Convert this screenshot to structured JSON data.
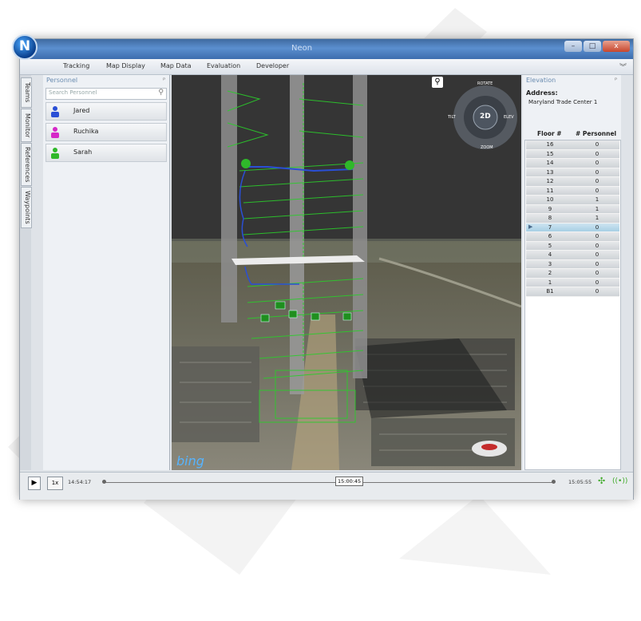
{
  "app": {
    "title": "Neon",
    "logo_letter": "N"
  },
  "window_buttons": [
    "–",
    "□",
    "x"
  ],
  "menu": [
    "Tracking",
    "Map Display",
    "Map Data",
    "Evaluation",
    "Developer"
  ],
  "side_tabs": [
    "Teams",
    "Monitor",
    "References",
    "Waypoints"
  ],
  "personnel": {
    "title": "Personnel",
    "pin": "ᴾ",
    "search_placeholder": "Search Personnel",
    "items": [
      {
        "name": "Jared",
        "color": "#2a4fd6"
      },
      {
        "name": "Ruchika",
        "color": "#d628c8"
      },
      {
        "name": "Sarah",
        "color": "#2fb82a"
      }
    ]
  },
  "map": {
    "watermark": "bing",
    "nav_labels": {
      "rotate": "ROTATE",
      "tilt": "TILT",
      "elev": "ELEV",
      "zoom": "ZOOM",
      "mode": "2D"
    }
  },
  "elevation": {
    "title": "Elevation",
    "pin": "ᴾ",
    "address_label": "Address:",
    "address": "Maryland Trade Center 1",
    "col_floor": "Floor #",
    "col_personnel": "# Personnel",
    "selected_floor": "7",
    "floors": [
      {
        "floor": "16",
        "count": "0"
      },
      {
        "floor": "15",
        "count": "0"
      },
      {
        "floor": "14",
        "count": "0"
      },
      {
        "floor": "13",
        "count": "0"
      },
      {
        "floor": "12",
        "count": "0"
      },
      {
        "floor": "11",
        "count": "0"
      },
      {
        "floor": "10",
        "count": "1"
      },
      {
        "floor": "9",
        "count": "1"
      },
      {
        "floor": "8",
        "count": "1"
      },
      {
        "floor": "7",
        "count": "0"
      },
      {
        "floor": "6",
        "count": "0"
      },
      {
        "floor": "5",
        "count": "0"
      },
      {
        "floor": "4",
        "count": "0"
      },
      {
        "floor": "3",
        "count": "0"
      },
      {
        "floor": "2",
        "count": "0"
      },
      {
        "floor": "1",
        "count": "0"
      },
      {
        "floor": "B1",
        "count": "0"
      }
    ]
  },
  "timeline": {
    "speed": "1x",
    "start": "14:54:17",
    "current": "15:00:45",
    "end": "15:05:55",
    "position": 0.5
  }
}
